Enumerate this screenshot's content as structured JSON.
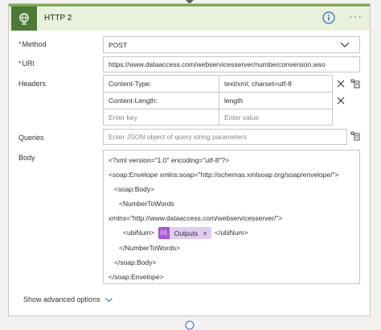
{
  "header": {
    "title": "HTTP 2"
  },
  "fields": {
    "method": {
      "label": "Method",
      "value": "POST"
    },
    "uri": {
      "label": "URI",
      "value": "https://www.dataaccess.com/webservicesserver/numberconversion.wso"
    },
    "headers": {
      "label": "Headers",
      "rows": [
        {
          "key": "Content-Type:",
          "value": "text/xml; charset=utf-8"
        },
        {
          "key": "Content-Length:",
          "value": "length"
        }
      ],
      "key_placeholder": "Enter key",
      "value_placeholder": "Enter value"
    },
    "queries": {
      "label": "Queries",
      "placeholder": "Enter JSON object of query string parameters"
    },
    "body": {
      "label": "Body",
      "lines": [
        "<?xml version=\"1.0\" encoding=\"utf-8\"?>",
        "<soap:Envelope xmlns:soap=\"http://schemas.xmlsoap.org/soap/envelope/\">",
        "<soap:Body>",
        "<NumberToWords",
        "xmlns=\"http://www.dataaccess.com/webservicesserver/\">",
        "<ubiNum>",
        "</ubiNum>",
        "</NumberToWords>",
        "</soap:Body>",
        "</soap:Envelope>"
      ],
      "token": {
        "icon_text": "{x}",
        "label": "Outputs"
      }
    }
  },
  "advanced": {
    "label": "Show advanced options"
  },
  "colors": {
    "header_bg": "#e9f1dc",
    "header_accent": "#7fa85a",
    "icon_bg": "#4c7a34",
    "token_bg": "#e1ccf1",
    "token_icon": "#a855d6",
    "link_blue": "#2b6bbf"
  }
}
